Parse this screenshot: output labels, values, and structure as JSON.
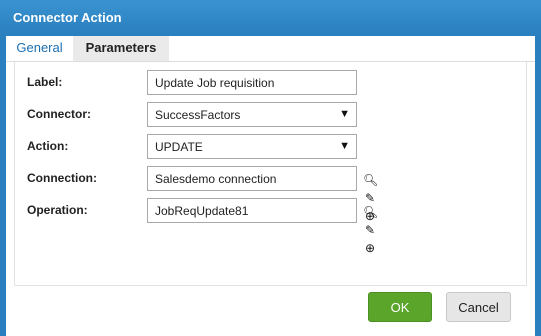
{
  "dialog": {
    "title": "Connector Action",
    "close_icon": "close-icon"
  },
  "tabs": [
    {
      "label": "General"
    },
    {
      "label": "Parameters"
    }
  ],
  "form": {
    "label": {
      "label": "Label:",
      "value": "Update Job requisition"
    },
    "connector": {
      "label": "Connector:",
      "value": "SuccessFactors"
    },
    "action": {
      "label": "Action:",
      "value": "UPDATE"
    },
    "connection": {
      "label": "Connection:",
      "value": "Salesdemo connection"
    },
    "operation": {
      "label": "Operation:",
      "value": "JobReqUpdate81"
    }
  },
  "footer": {
    "ok": "OK",
    "cancel": "Cancel"
  },
  "colors": {
    "title_bar": "#2a7fbe",
    "ok_button": "#5aa52a"
  }
}
